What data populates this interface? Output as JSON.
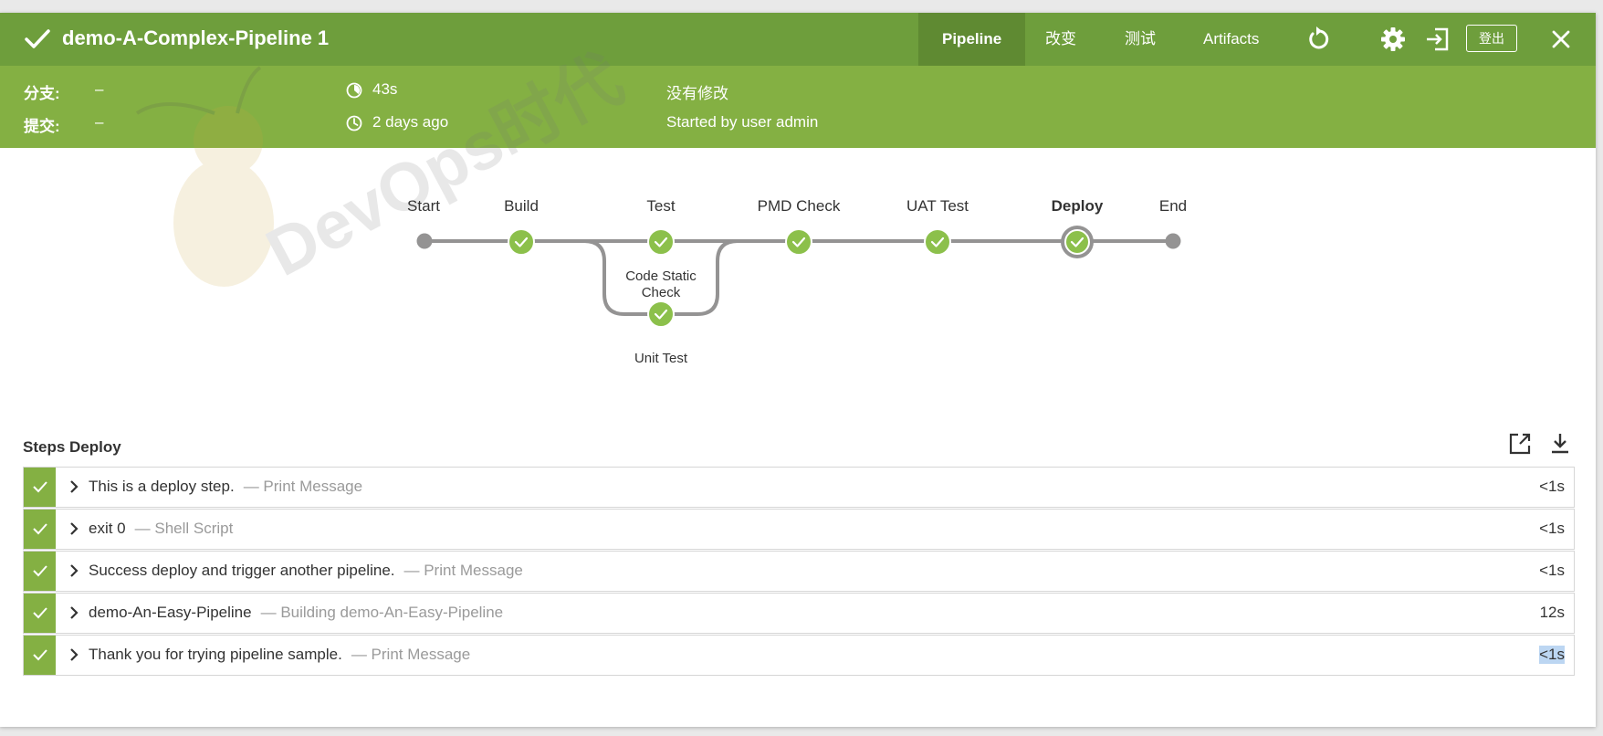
{
  "header": {
    "title": "demo-A-Complex-Pipeline 1",
    "tabs": [
      {
        "label": "Pipeline",
        "active": true
      },
      {
        "label": "改变",
        "active": false
      },
      {
        "label": "测试",
        "active": false
      },
      {
        "label": "Artifacts",
        "active": false
      }
    ],
    "logout_label": "登出",
    "icons": [
      "checkmark-icon",
      "rerun-icon",
      "gear-icon",
      "exit-icon",
      "close-icon"
    ],
    "bar_color": "#6e9e3c",
    "active_tab_color": "#5f8a32"
  },
  "meta": {
    "branch_label": "分支:",
    "branch_value": "–",
    "commit_label": "提交:",
    "commit_value": "–",
    "duration": "43s",
    "time_ago": "2 days ago",
    "changes": "没有修改",
    "started_by": "Started by user admin",
    "bar_color": "#84b043"
  },
  "watermark": "DevOps时代",
  "pipeline": {
    "stages": [
      "Start",
      "Build",
      "Test",
      "PMD Check",
      "UAT Test",
      "Deploy",
      "End"
    ],
    "selected_stage": "Deploy",
    "parallel_branches": [
      "Code Static Check",
      "Unit Test"
    ],
    "code_static_line1": "Code Static",
    "code_static_line2": "Check",
    "success_color": "#8cc04b"
  },
  "steps": {
    "title": "Steps Deploy",
    "items": [
      {
        "name": "This is a deploy step.",
        "type": "— Print Message",
        "duration": "<1s"
      },
      {
        "name": "exit 0",
        "type": "— Shell Script",
        "duration": "<1s"
      },
      {
        "name": "Success deploy and trigger another pipeline.",
        "type": "— Print Message",
        "duration": "<1s"
      },
      {
        "name": "demo-An-Easy-Pipeline",
        "type": "— Building demo-An-Easy-Pipeline",
        "duration": "12s"
      },
      {
        "name": "Thank you for trying pipeline sample.",
        "type": "— Print Message",
        "duration": "<1s"
      }
    ]
  }
}
